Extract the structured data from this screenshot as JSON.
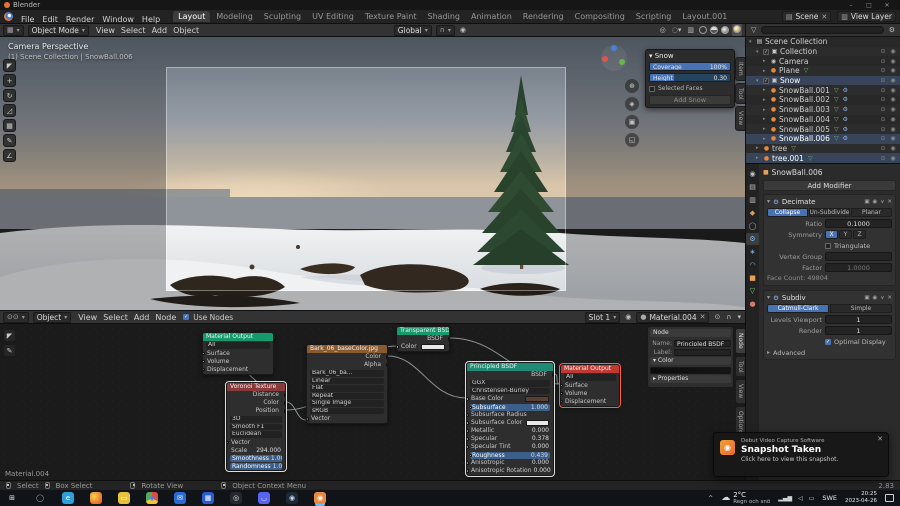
{
  "titlebar": {
    "app": "Blender",
    "min": "–",
    "max": "□",
    "close": "✕"
  },
  "topbar": {
    "menus": [
      "File",
      "Edit",
      "Render",
      "Window",
      "Help"
    ],
    "workspaces": [
      {
        "label": "Layout",
        "cls": "active"
      },
      {
        "label": "Modeling"
      },
      {
        "label": "Sculpting"
      },
      {
        "label": "UV Editing"
      },
      {
        "label": "Texture Paint"
      },
      {
        "label": "Shading"
      },
      {
        "label": "Animation"
      },
      {
        "label": "Rendering"
      },
      {
        "label": "Compositing"
      },
      {
        "label": "Scripting"
      },
      {
        "label": "Layout.001"
      }
    ],
    "scene_label": "Scene",
    "viewlayer_label": "View Layer"
  },
  "viewport": {
    "header": {
      "mode": "Object Mode",
      "menus": [
        "View",
        "Select",
        "Add",
        "Object"
      ],
      "orientation": "Global"
    },
    "tools": [
      {
        "glyph": "◤",
        "name": "select-box-tool"
      },
      {
        "glyph": "+",
        "name": "move-tool"
      },
      {
        "glyph": "↻",
        "name": "rotate-tool"
      },
      {
        "glyph": "◿",
        "name": "scale-tool"
      },
      {
        "glyph": "▦",
        "name": "transform-tool"
      },
      {
        "glyph": "✎",
        "name": "annotate-tool"
      },
      {
        "glyph": "∠",
        "name": "measure-tool"
      }
    ],
    "overlay": {
      "line1": "Camera Perspective",
      "line2": "(1) Scene Collection | SnowBall.006"
    },
    "nav_icons": [
      {
        "glyph": "⊕",
        "name": "zoom-icon"
      },
      {
        "glyph": "◈",
        "name": "pan-icon"
      },
      {
        "glyph": "▣",
        "name": "camera-view-icon"
      },
      {
        "glyph": "◱",
        "name": "ortho-toggle-icon"
      }
    ],
    "snow_panel": {
      "title": "▾ Snow",
      "rows": [
        {
          "label": "Coverage",
          "value": "100%",
          "fill": "100%"
        },
        {
          "label": "Height",
          "value": "0.30",
          "fill": "30%"
        }
      ],
      "checkbox": "Selected Faces",
      "button": "Add Snow"
    },
    "side_tabs": [
      {
        "label": "Item"
      },
      {
        "label": "Tool"
      },
      {
        "label": "View"
      }
    ]
  },
  "outliner": {
    "rows": [
      {
        "label": "Scene Collection",
        "caret": "▾",
        "i1": "▤",
        "c1": "#cccccc",
        "indent": 0,
        "cls": "noR"
      },
      {
        "label": "Collection",
        "caret": "▾",
        "i1": "▣",
        "c1": "#cccccc",
        "indent": 1,
        "cls": "col"
      },
      {
        "label": "Camera",
        "caret": "▸",
        "i1": "◉",
        "c1": "#c8c8c8",
        "indent": 2
      },
      {
        "label": "Plane",
        "caret": "▸",
        "i1": "●",
        "c1": "#e8883a",
        "i2": "▽",
        "c2": "#6ab36a",
        "indent": 2
      },
      {
        "label": "Snow",
        "caret": "▾",
        "i1": "▣",
        "c1": "#cccccc",
        "indent": 1,
        "cls": "col sel"
      },
      {
        "label": "SnowBall.001",
        "caret": "▸",
        "i1": "●",
        "c1": "#e8883a",
        "i2": "▽",
        "c2": "#6ab36a",
        "i3": "⚙",
        "c3": "#8ab4e8",
        "indent": 2
      },
      {
        "label": "SnowBall.002",
        "caret": "▸",
        "i1": "●",
        "c1": "#e8883a",
        "i2": "▽",
        "c2": "#6ab36a",
        "i3": "⚙",
        "c3": "#8ab4e8",
        "indent": 2
      },
      {
        "label": "SnowBall.003",
        "caret": "▸",
        "i1": "●",
        "c1": "#e8883a",
        "i2": "▽",
        "c2": "#6ab36a",
        "i3": "⚙",
        "c3": "#8ab4e8",
        "indent": 2
      },
      {
        "label": "SnowBall.004",
        "caret": "▸",
        "i1": "●",
        "c1": "#e8883a",
        "i2": "▽",
        "c2": "#6ab36a",
        "i3": "⚙",
        "c3": "#8ab4e8",
        "indent": 2
      },
      {
        "label": "SnowBall.005",
        "caret": "▸",
        "i1": "●",
        "c1": "#e8883a",
        "i2": "▽",
        "c2": "#6ab36a",
        "i3": "⚙",
        "c3": "#8ab4e8",
        "indent": 2
      },
      {
        "label": "SnowBall.006",
        "caret": "▸",
        "i1": "●",
        "c1": "#e8883a",
        "i2": "▽",
        "c2": "#6ab36a",
        "i3": "⚙",
        "c3": "#8ab4e8",
        "indent": 2,
        "cls": "sel"
      },
      {
        "label": "tree",
        "caret": "▸",
        "i1": "●",
        "c1": "#e8883a",
        "i2": "▽",
        "c2": "#6ab36a",
        "indent": 1
      },
      {
        "label": "tree.001",
        "caret": "▸",
        "i1": "●",
        "c1": "#e8883a",
        "i2": "▽",
        "c2": "#6ab36a",
        "indent": 1,
        "cls": "sel"
      }
    ]
  },
  "properties": {
    "tabs": [
      {
        "glyph": "◉",
        "c": "#c0c0c0",
        "name": "render"
      },
      {
        "glyph": "▤",
        "c": "#c0c0c0",
        "name": "output"
      },
      {
        "glyph": "▥",
        "c": "#c0c0c0",
        "name": "view-layer"
      },
      {
        "glyph": "◆",
        "c": "#d8a15a",
        "name": "scene"
      },
      {
        "glyph": "◯",
        "c": "#9ab0d8",
        "name": "world"
      },
      {
        "glyph": "⚙",
        "c": "#8ab9e8",
        "cls": "active",
        "name": "modifiers"
      },
      {
        "glyph": "∗",
        "c": "#8ab9e8",
        "name": "particles"
      },
      {
        "glyph": "◠",
        "c": "#8ab9e8",
        "name": "physics"
      },
      {
        "glyph": "■",
        "c": "#e8a15a",
        "name": "object"
      },
      {
        "glyph": "▽",
        "c": "#7ad87a",
        "name": "object-data"
      },
      {
        "glyph": "●",
        "c": "#d87a6a",
        "name": "material"
      }
    ],
    "breadcrumb": "SnowBall.006",
    "add_modifier": "Add Modifier",
    "decimate": {
      "title": "Decimate",
      "tabs": [
        {
          "label": "Collapse",
          "cls": "active"
        },
        {
          "label": "Un-Subdivide"
        },
        {
          "label": "Planar"
        }
      ],
      "ratio_label": "Ratio",
      "ratio_value": "0.1000",
      "symmetry_label": "Symmetry",
      "axes": [
        {
          "label": "X",
          "cls": "active"
        },
        {
          "label": "Y"
        },
        {
          "label": "Z"
        }
      ],
      "triangulate": "Triangulate",
      "vertex_group": "Vertex Group",
      "factor_label": "Factor",
      "factor_value": "1.0000",
      "face_count": "Face Count: 49804"
    },
    "subdiv": {
      "title": "Subdiv",
      "tabs": [
        {
          "label": "Catmull-Clark",
          "cls": "active"
        },
        {
          "label": "Simple"
        }
      ],
      "levels_label": "Levels Viewport",
      "levels_value": "1",
      "render_label": "Render",
      "render_value": "1",
      "optimal": "Optimal Display",
      "advanced": "Advanced"
    }
  },
  "shader": {
    "header": {
      "mode": "Object",
      "menus": [
        "View",
        "Select",
        "Add",
        "Node"
      ],
      "use_nodes": "Use Nodes",
      "slot": "Slot 1",
      "material": "Material.004"
    },
    "corner_label": "Material.004",
    "side_tabs": [
      {
        "label": "Node",
        "cls": "active"
      },
      {
        "label": "Tool"
      },
      {
        "label": "View"
      },
      {
        "label": "Options"
      }
    ],
    "npanel": {
      "title": "Node",
      "name_label": "Name:",
      "name_value": "Principled BSDF",
      "label_label": "Label:",
      "label_value": "",
      "color_title": "▾ Color",
      "properties_title": "▸ Properties"
    },
    "nodes": {
      "out1": {
        "title": "Material Output",
        "hd": "#159a6e",
        "rows": [
          {
            "label": "All",
            "cls": "sel"
          },
          {
            "label": "Surface",
            "cls": "in",
            "sock": "#63c763"
          },
          {
            "label": "Volume",
            "cls": "in",
            "sock": "#63c763"
          },
          {
            "label": "Displacement",
            "cls": "in",
            "sock": "#6363c7"
          }
        ]
      },
      "voronoi": {
        "title": "Voronoi Texture",
        "hd": "#8a3a3a",
        "rows": [
          {
            "label": "Distance",
            "cls": "out",
            "sock": "#a0a0a0"
          },
          {
            "label": "Color",
            "cls": "out",
            "sock": "#c8c832"
          },
          {
            "label": "Position",
            "cls": "out",
            "sock": "#6363c7"
          },
          {
            "label": "3D",
            "cls": "sel"
          },
          {
            "label": "Smooth F1",
            "cls": "sel"
          },
          {
            "label": "Euclidean",
            "cls": "sel"
          },
          {
            "label": "Vector",
            "cls": "in",
            "sock": "#6363c7"
          },
          {
            "label": "Scale",
            "value": "294.000",
            "cls": "val"
          },
          {
            "label": "Smoothness",
            "value": "1.000",
            "cls": "val fill"
          },
          {
            "label": "Randomness",
            "value": "1.000",
            "cls": "val fill"
          }
        ]
      },
      "bark": {
        "title": "Bark_06_baseColor.jpg",
        "hd": "#8a5a30",
        "rows": [
          {
            "label": "Color",
            "cls": "out",
            "sock": "#c8c832"
          },
          {
            "label": "Alpha",
            "cls": "out",
            "sock": "#a0a0a0"
          },
          {
            "label": "Bark_06_ba...",
            "cls": "sel"
          },
          {
            "label": "Linear",
            "cls": "sel"
          },
          {
            "label": "Flat",
            "cls": "sel"
          },
          {
            "label": "Repeat",
            "cls": "sel"
          },
          {
            "label": "Single Image",
            "cls": "sel"
          },
          {
            "label": "sRGB",
            "cls": "sel"
          },
          {
            "label": "Vector",
            "cls": "in",
            "sock": "#6363c7"
          }
        ]
      },
      "transparent": {
        "title": "Transparent BSDF",
        "hd": "#159a6e",
        "rows": [
          {
            "label": "BSDF",
            "cls": "out",
            "sock": "#63c763"
          },
          {
            "label": "Color",
            "cls": "in swatch",
            "sock": "#c8c832",
            "sw": "#e8e8e8"
          }
        ]
      },
      "principled": {
        "title": "Principled BSDF",
        "hd": "#1f8a74",
        "rows": [
          {
            "label": "BSDF",
            "cls": "out",
            "sock": "#63c763"
          },
          {
            "label": "GGX",
            "cls": "sel"
          },
          {
            "label": "Christensen-Burley",
            "cls": "sel"
          },
          {
            "label": "Base Color",
            "cls": "in swatch",
            "sock": "#c8c832",
            "sw": "#5a4032"
          },
          {
            "label": "Subsurface",
            "value": "1.000",
            "cls": "in val fill",
            "sock": "#a0a0a0"
          },
          {
            "label": "Subsurface Radius",
            "cls": "in",
            "sock": "#6363c7"
          },
          {
            "label": "Subsurface Color",
            "cls": "in swatch",
            "sock": "#c8c832",
            "sw": "#e8e8e8"
          },
          {
            "label": "Metallic",
            "value": "0.000",
            "cls": "in val",
            "sock": "#a0a0a0"
          },
          {
            "label": "Specular",
            "value": "0.378",
            "cls": "in val",
            "sock": "#a0a0a0"
          },
          {
            "label": "Specular Tint",
            "value": "0.000",
            "cls": "in val",
            "sock": "#a0a0a0"
          },
          {
            "label": "Roughness",
            "value": "0.439",
            "cls": "in val fill",
            "sock": "#a0a0a0"
          },
          {
            "label": "Anisotropic",
            "value": "0.000",
            "cls": "in val",
            "sock": "#a0a0a0"
          },
          {
            "label": "Anisotropic Rotation",
            "value": "0.000",
            "cls": "in val",
            "sock": "#a0a0a0"
          }
        ]
      },
      "out2": {
        "title": "Material Output",
        "hd": "#c03a34",
        "rows": [
          {
            "label": "All",
            "cls": "sel"
          },
          {
            "label": "Surface",
            "cls": "in",
            "sock": "#63c763"
          },
          {
            "label": "Volume",
            "cls": "in",
            "sock": "#63c763"
          },
          {
            "label": "Displacement",
            "cls": "in",
            "sock": "#6363c7"
          }
        ]
      }
    }
  },
  "statusbar": {
    "select": "Select",
    "box_select": "Box Select",
    "rotate": "Rotate View",
    "context": "Object Context Menu",
    "version": "2.83"
  },
  "taskbar": {
    "apps": [
      {
        "name": "start",
        "glyph": "⊞",
        "bg": "transparent",
        "fg": "#e8e8e8"
      },
      {
        "name": "search",
        "glyph": "◯",
        "bg": "transparent",
        "fg": "#b8b8b8"
      },
      {
        "name": "edge",
        "glyph": "e",
        "bg": "#2e9fd8",
        "fg": "#ffffff"
      },
      {
        "name": "firefox",
        "glyph": "",
        "bg": "radial-gradient(circle at 35% 35%, #f8d84a, #e8702a 70%)",
        "fg": "#fff"
      },
      {
        "name": "file-explorer",
        "glyph": "▭",
        "bg": "#e8c33a",
        "fg": "#fff8e0"
      },
      {
        "name": "chrome",
        "glyph": "◉",
        "bg": "conic-gradient(#e8483c 0 120deg, #f5c63a 120deg 240deg, #57a85c 240deg 360deg)",
        "fg": "#4a7fe8"
      },
      {
        "name": "mail",
        "glyph": "✉",
        "bg": "#2a6ad4",
        "fg": "#ffffff"
      },
      {
        "name": "photos",
        "glyph": "▦",
        "bg": "#2a5ad4",
        "fg": "#ffffff"
      },
      {
        "name": "obs",
        "glyph": "◎",
        "bg": "#24292e",
        "fg": "#e8e8e8"
      },
      {
        "name": "discord",
        "glyph": "◡",
        "bg": "#5865f2",
        "fg": "#ffffff"
      },
      {
        "name": "steam",
        "glyph": "◉",
        "bg": "#1b2838",
        "fg": "#c8d8e8"
      },
      {
        "name": "blender",
        "glyph": "◉",
        "bg": "#e87d2a",
        "fg": "#ffffff",
        "cls": "active"
      }
    ],
    "tray_caret": "^",
    "tray_icons": [
      {
        "glyph": "▂▄▆",
        "name": "network-icon"
      },
      {
        "glyph": "◁",
        "name": "volume-icon"
      },
      {
        "glyph": "▭",
        "name": "battery-icon"
      }
    ],
    "weather_temp": "2°C",
    "weather_desc": "Regn och snö",
    "lang": "SWE",
    "time": "20:25",
    "date": "2023-04-26"
  },
  "toast": {
    "app": "Debut Video Capture Software",
    "title": "Snapshot Taken",
    "body": "Click here to view this snapshot.",
    "close": "✕"
  }
}
